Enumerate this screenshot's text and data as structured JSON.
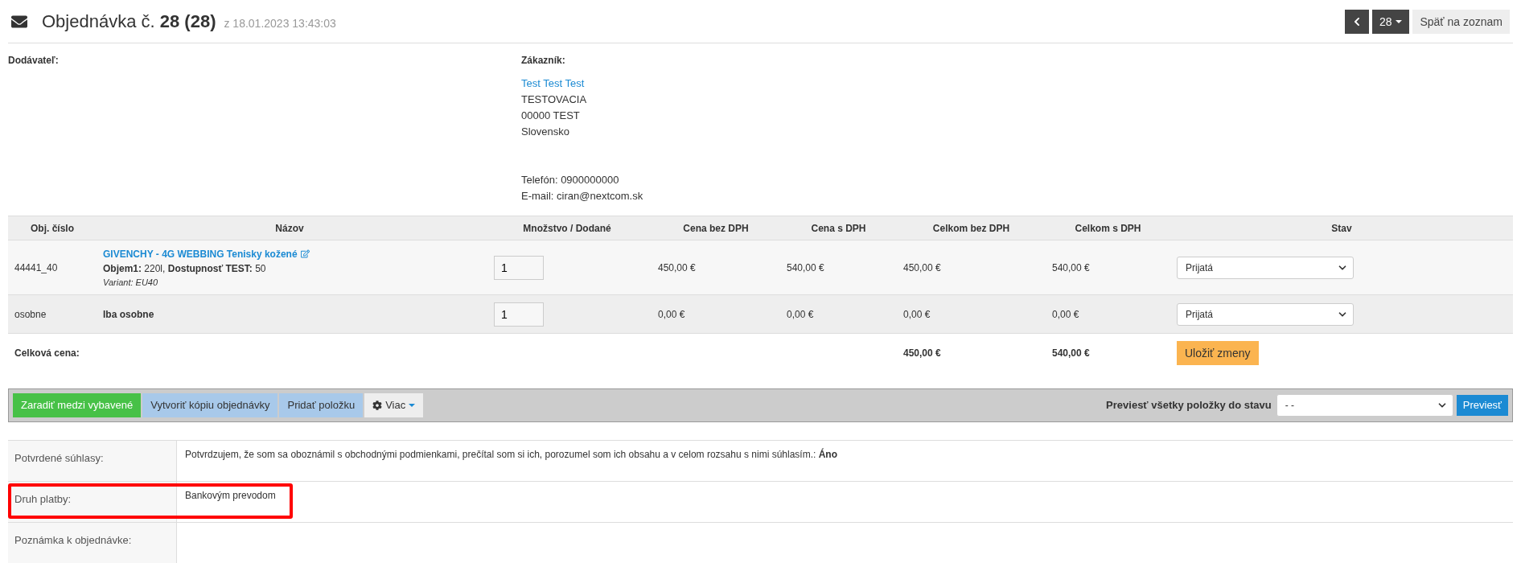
{
  "header": {
    "title": "Objednávka č.",
    "number": "28 (28)",
    "date": "z 18.01.2023 13:43:03"
  },
  "nav": {
    "page": "28",
    "back": "Späť na zoznam"
  },
  "supplier": {
    "label": "Dodávateľ:"
  },
  "customer": {
    "label": "Zákazník:",
    "name": "Test Test Test",
    "lines": [
      "TESTOVACIA",
      "00000 TEST",
      "Slovensko"
    ],
    "phone": "Telefón: 0900000000",
    "email": "E-mail: ciran@nextcom.sk"
  },
  "table": {
    "columns": [
      "Obj. číslo",
      "Názov",
      "Množstvo / Dodané",
      "Cena bez DPH",
      "Cena s DPH",
      "Celkom bez DPH",
      "Celkom s DPH",
      "Stav"
    ],
    "rows": [
      {
        "kind": "product",
        "code": "44441_40",
        "name": "GIVENCHY - 4G WEBBING Tenisky kožené",
        "attributes": "**Objem1:** 220l, **Dostupnosť TEST:** 50",
        "variant": "Variant: EU40",
        "quantity": "1",
        "price": "450,00 €",
        "price_vat": "540,00 €",
        "total": "450,00 €",
        "total_vat": "540,00 €",
        "status": "Prijatá"
      },
      {
        "kind": "plain",
        "code": "osobne",
        "name": "Iba osobne",
        "quantity": "1",
        "price": "0,00 €",
        "price_vat": "0,00 €",
        "total": "0,00 €",
        "total_vat": "0,00 €",
        "status": "Prijatá"
      }
    ],
    "total": {
      "label": "Celková cena:",
      "total": "450,00 €",
      "total_vat": "540,00 €",
      "save": "Uložiť zmeny"
    }
  },
  "toolbar": {
    "buttons": [
      {
        "label": "Zaradiť medzi vybavené",
        "kind": "success"
      },
      {
        "label": "Vytvoriť kópiu objednávky",
        "kind": "info"
      },
      {
        "label": "Pridať položku",
        "kind": "info"
      },
      {
        "label": "Viac",
        "kind": "dropdown"
      }
    ],
    "transfer_label": "Previesť všetky položky do stavu",
    "transfer_value": "- -",
    "transfer_button": "Previesť"
  },
  "info_rows": [
    {
      "label": "Potvrdené súhlasy:",
      "value": "Potvrdzujem, že som sa oboznámil s obchodnými podmienkami, prečítal som si ich, porozumel som ich obsahu a v celom rozsahu s nimi súhlasím.: **Áno**",
      "highlighted": false
    },
    {
      "label": "Druh platby:",
      "value": "Bankovým prevodom",
      "highlighted": true
    },
    {
      "label": "Poznámka k objednávke:",
      "value": "",
      "highlighted": false
    }
  ]
}
